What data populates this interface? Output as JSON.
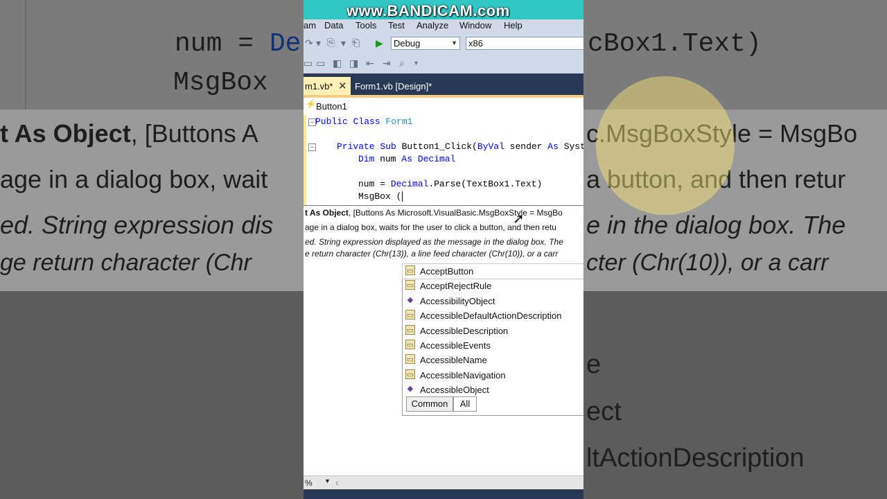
{
  "watermark": "www.BANDICAM.com",
  "menu": [
    "am",
    "Data",
    "Tools",
    "Test",
    "Analyze",
    "Window",
    "Help"
  ],
  "toolbar": {
    "config": "Debug",
    "platform": "x86"
  },
  "tabs": {
    "active": "m1.vb*",
    "other": "Form1.vb [Design]*"
  },
  "navbar": {
    "object": "Button1"
  },
  "code": {
    "l1_kw": "Public Class",
    "l1_name": " Form1",
    "l2_kw1": "Private Sub",
    "l2_name": " Button1_Click(",
    "l2_kw2": "ByVal",
    "l2_rest": " sender ",
    "l2_kw3": "As",
    "l2_tail": " Syst",
    "l3_kw": "Dim",
    "l3_name": " num ",
    "l3_kw2": "As",
    "l3_type": " Decimal",
    "l4_name": "num = ",
    "l4_type": "Decimal",
    "l4_rest": ".Parse(TextBox1.Text)",
    "l5": "MsgBox ("
  },
  "tooltip": {
    "sig_bold": "t As Object",
    "sig_rest": ", [Buttons As Microsoft.VisualBasic.MsgBoxStyle = MsgBo",
    "desc": "age in a dialog box, waits for the user to click a button, and then retu",
    "param1": "ed. String expression displayed as the message in the dialog box. The",
    "param2": "e return character (Chr(13)), a line feed character (Chr(10)), or a carr"
  },
  "completion": {
    "items": [
      {
        "label": "AcceptButton",
        "icon": "property-icon"
      },
      {
        "label": "AcceptRejectRule",
        "icon": "property-icon"
      },
      {
        "label": "AccessibilityObject",
        "icon": "method-icon"
      },
      {
        "label": "AccessibleDefaultActionDescription",
        "icon": "property-icon"
      },
      {
        "label": "AccessibleDescription",
        "icon": "property-icon"
      },
      {
        "label": "AccessibleEvents",
        "icon": "property-icon"
      },
      {
        "label": "AccessibleName",
        "icon": "property-icon"
      },
      {
        "label": "AccessibleNavigation",
        "icon": "property-icon"
      },
      {
        "label": "AccessibleObject",
        "icon": "method-icon"
      }
    ],
    "tab_common": "Common",
    "tab_all": "All"
  },
  "status": {
    "zoom": "%"
  },
  "background": {
    "code1_name": "num = ",
    "code1_frag": "De",
    "code1_tail": "cBox1.Text)",
    "code2": "MsgBox",
    "tip1_bold": "t As Object",
    "tip1_a": ", [Buttons A",
    "tip1_b": "c.MsgBoxStyle = MsgBo",
    "tip2_a": "age in a dialog box, wait",
    "tip2_b": "a button, and then retur",
    "tip3_a": "ed. String expression dis",
    "tip3_b": "e in the dialog box. The",
    "tip4_a": "ge return character (Chr",
    "tip4_b": "cter (Chr(10)), or a carr",
    "list1": "e",
    "list2": "ect",
    "list3": "ltActionDescription"
  }
}
